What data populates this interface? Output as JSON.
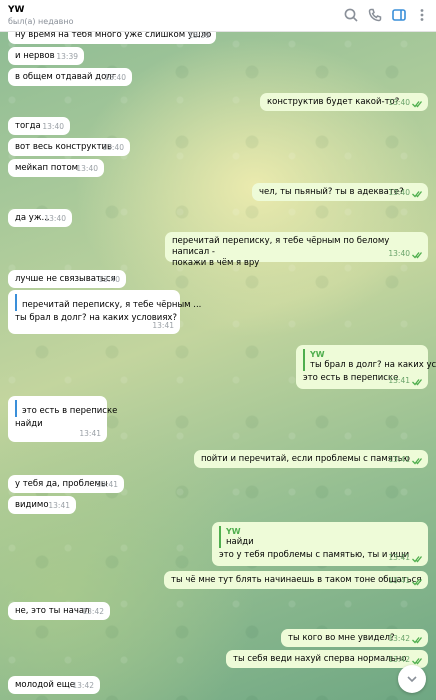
{
  "header": {
    "contact_name": "YW",
    "status": "был(а) недавно",
    "icons": [
      "search-icon",
      "phone-icon",
      "sidebar-toggle-icon",
      "more-menu-icon"
    ]
  },
  "messages": [
    {
      "dir": "in",
      "text": "ну время на тебя много уже слишком ушло",
      "time": "13:39"
    },
    {
      "dir": "in",
      "text": "и нервов",
      "time": "13:39"
    },
    {
      "dir": "in",
      "text": "в общем отдавай долг",
      "time": "13:40"
    },
    {
      "dir": "out",
      "text": "конструктив будет какой-то?",
      "time": "13:40"
    },
    {
      "dir": "in",
      "text": "тогда",
      "time": "13:40"
    },
    {
      "dir": "in",
      "text": "вот весь конструктив",
      "time": "13:40"
    },
    {
      "dir": "in",
      "text": "мейкап потом",
      "time": "13:40"
    },
    {
      "dir": "out",
      "text": "чел, ты пьяный? ты в адеквате?",
      "time": "13:40"
    },
    {
      "dir": "in",
      "text": "да уж...",
      "time": "13:40"
    },
    {
      "dir": "out",
      "text": "перечитай переписку, я тебе чёрным по белому написал - покажи в чём я вру",
      "line1": "перечитай переписку, я тебе чёрным по белому написал -",
      "line2": "покажи в чём я вру",
      "time": "13:40"
    },
    {
      "dir": "in",
      "text": "лучше не связываться",
      "time": "13:40"
    },
    {
      "dir": "in",
      "quote_author": "",
      "quote_text": "перечитай переписку, я тебе чёрным ...",
      "text": "ты брал в долг? на каких условиях?",
      "time": "13:41"
    },
    {
      "dir": "out",
      "quote_author": "YW",
      "quote_text": "ты брал в долг? на каких ус...",
      "text": "это есть в переписке",
      "time": "13:41"
    },
    {
      "dir": "in",
      "quote_author": "",
      "quote_text": "это есть в переписке",
      "text": "найди",
      "time": "13:41"
    },
    {
      "dir": "out",
      "text": "пойти и перечитай, если проблемы с памятью",
      "time": "13:41"
    },
    {
      "dir": "in",
      "text": "у тебя да, проблемы",
      "time": "13:41"
    },
    {
      "dir": "in",
      "text": "видимо",
      "time": "13:41"
    },
    {
      "dir": "out",
      "quote_author": "YW",
      "quote_text": "найди",
      "text": "это у тебя проблемы с памятью, ты и ищи",
      "time": "13:41"
    },
    {
      "dir": "out",
      "text": "ты чё мне тут блять начинаешь в таком тоне общаться",
      "time": "13:41"
    },
    {
      "dir": "in",
      "text": "не, это ты начал",
      "time": "13:42"
    },
    {
      "dir": "out",
      "text": "ты кого во мне увидел?",
      "time": "13:42"
    },
    {
      "dir": "out",
      "text": "ты себя веди нахуй сперва нормально",
      "time": "13:42"
    },
    {
      "dir": "in",
      "text": "молодой еще",
      "time": "13:42"
    }
  ],
  "colors": {
    "incoming_bubble": "#ffffff",
    "outgoing_bubble": "#eefbd8",
    "read_check": "#4fae4e",
    "quote_bar_in": "#3a8fd9"
  }
}
